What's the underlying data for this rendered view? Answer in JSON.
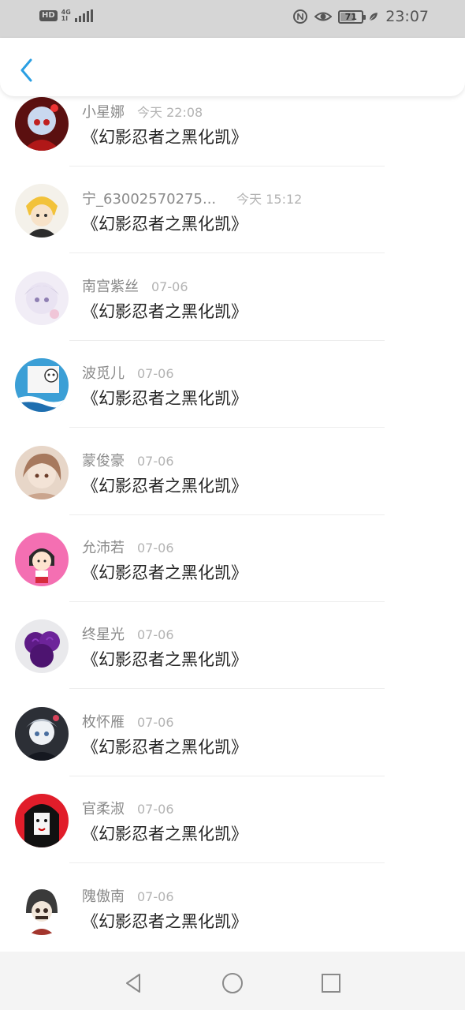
{
  "status_bar": {
    "hd": "HD",
    "network": "4G",
    "network_sub": "1l",
    "battery": "71",
    "battery_level": 0.71,
    "time": "23:07",
    "icons": [
      "hd-icon",
      "signal-icon",
      "nfc-icon",
      "eye-comfort-icon",
      "battery-icon",
      "leaf-icon"
    ]
  },
  "header": {
    "back_icon": "back-arrow-icon",
    "accent": "#2a9fe3"
  },
  "messages": [
    {
      "name": "小星娜",
      "time": "今天 22:08",
      "text": "《幻影忍者之黑化凯》"
    },
    {
      "name": "宁_63002570275...",
      "time": "今天 15:12",
      "text": "《幻影忍者之黑化凯》"
    },
    {
      "name": "南宫紫丝",
      "time": "07-06",
      "text": "《幻影忍者之黑化凯》"
    },
    {
      "name": "波觅儿",
      "time": "07-06",
      "text": "《幻影忍者之黑化凯》"
    },
    {
      "name": "蒙俊豪",
      "time": "07-06",
      "text": "《幻影忍者之黑化凯》"
    },
    {
      "name": "允沛若",
      "time": "07-06",
      "text": "《幻影忍者之黑化凯》"
    },
    {
      "name": "终星光",
      "time": "07-06",
      "text": "《幻影忍者之黑化凯》"
    },
    {
      "name": "枚怀雁",
      "time": "07-06",
      "text": "《幻影忍者之黑化凯》"
    },
    {
      "name": "官柔淑",
      "time": "07-06",
      "text": "《幻影忍者之黑化凯》"
    },
    {
      "name": "隗傲南",
      "time": "07-06",
      "text": "《幻影忍者之黑化凯》"
    }
  ],
  "nav_bar": {
    "back": "nav-back-icon",
    "home": "nav-home-icon",
    "recents": "nav-recents-icon"
  }
}
